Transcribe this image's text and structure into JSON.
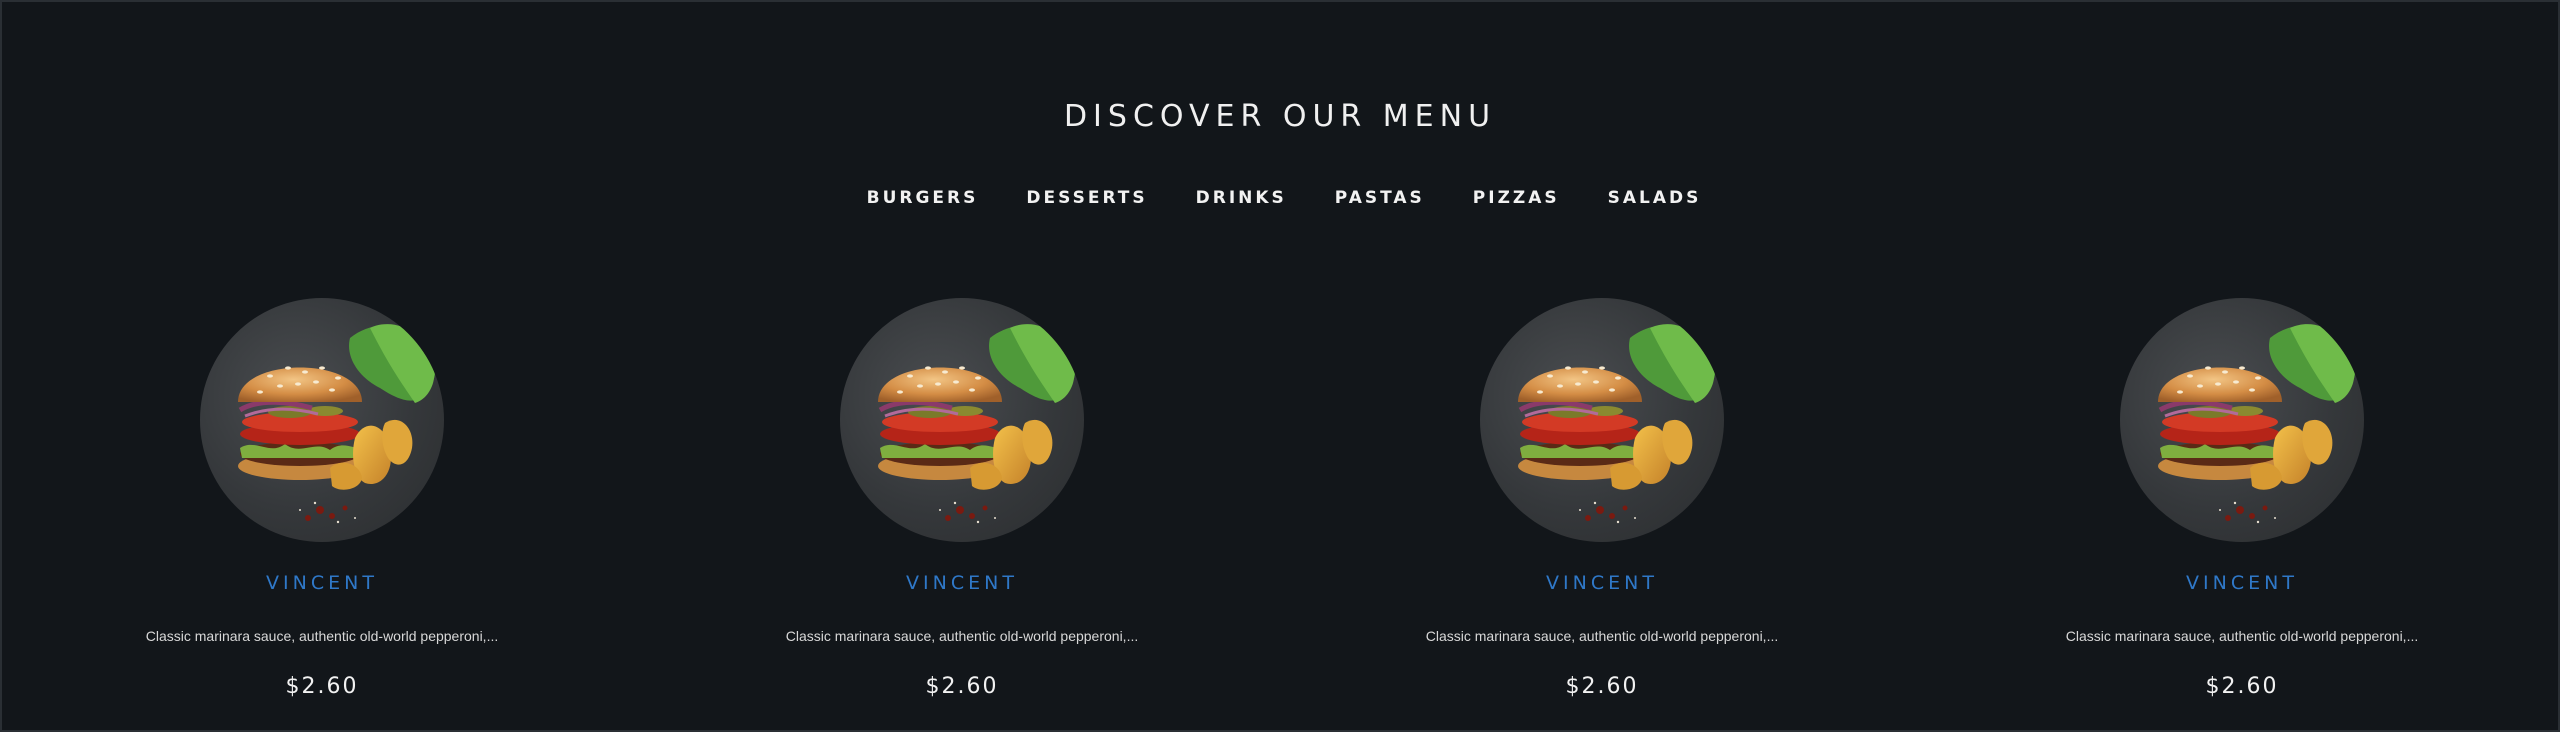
{
  "menu": {
    "title": "DISCOVER OUR MENU",
    "tabs": [
      {
        "label": "BURGERS"
      },
      {
        "label": "DESSERTS"
      },
      {
        "label": "DRINKS"
      },
      {
        "label": "PASTAS"
      },
      {
        "label": "PIZZAS"
      },
      {
        "label": "SALADS"
      }
    ],
    "items": [
      {
        "name": "VINCENT",
        "description": "Classic marinara sauce, authentic old-world pepperoni,...",
        "price": "$2.60",
        "image": "burger-image"
      },
      {
        "name": "VINCENT",
        "description": "Classic marinara sauce, authentic old-world pepperoni,...",
        "price": "$2.60",
        "image": "burger-image"
      },
      {
        "name": "VINCENT",
        "description": "Classic marinara sauce, authentic old-world pepperoni,...",
        "price": "$2.60",
        "image": "burger-image"
      },
      {
        "name": "VINCENT",
        "description": "Classic marinara sauce, authentic old-world pepperoni,...",
        "price": "$2.60",
        "image": "burger-image"
      }
    ]
  },
  "colors": {
    "background": "#12161a",
    "accent": "#2f78c8",
    "text": "#f2f2f2"
  }
}
